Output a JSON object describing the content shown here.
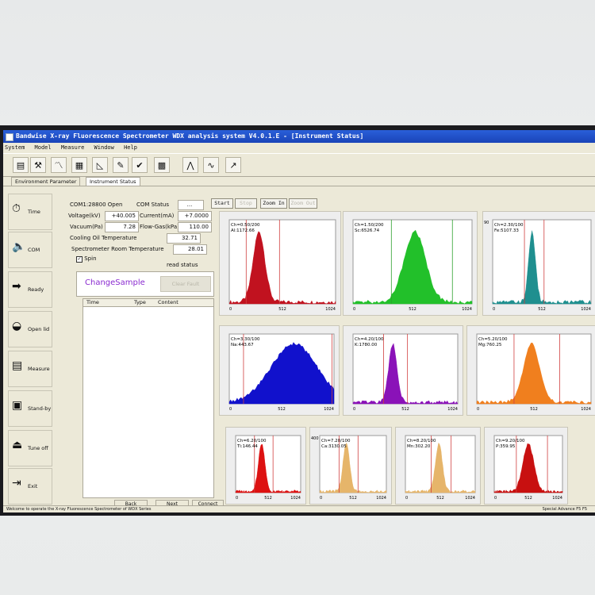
{
  "window": {
    "title": "Bandwise X-ray Fluorescence Spectrometer WDX analysis system V4.0.1.E - [Instrument Status]"
  },
  "menu": [
    "System",
    "Model",
    "Measure",
    "Window",
    "Help"
  ],
  "tabs": [
    "Environment Parameter",
    "Instrument Status"
  ],
  "sidebar": [
    {
      "label": "Time",
      "icon": "clock-icon",
      "glyph": "⏱"
    },
    {
      "label": "COM",
      "icon": "speaker-icon",
      "glyph": "🔈"
    },
    {
      "label": "Ready",
      "icon": "ready-icon",
      "glyph": "➡"
    },
    {
      "label": "Open lid",
      "icon": "open-lid-icon",
      "glyph": "◒"
    },
    {
      "label": "Measure",
      "icon": "measure-icon",
      "glyph": "▤"
    },
    {
      "label": "Stand-by",
      "icon": "standby-icon",
      "glyph": "▣"
    },
    {
      "label": "Tune off",
      "icon": "tune-off-icon",
      "glyph": "⏏"
    },
    {
      "label": "Exit",
      "icon": "exit-icon",
      "glyph": "⇥"
    }
  ],
  "status": {
    "com": "COM1:28800 Open",
    "com_status_label": "COM Status",
    "com_status_value": "...",
    "voltage_label": "Voltage(kV)",
    "voltage_value": "+40.005",
    "current_label": "Current(mA)",
    "current_value": "+7.0000",
    "vacuum_label": "Vacuum(Pa)",
    "vacuum_value": "7.28",
    "flowgas_label": "Flow-Gas(kPa)",
    "flowgas_value": "110.00",
    "oil_label": "Cooling Oil Temperature",
    "oil_value": "32.71",
    "room_label": "Spectrometer Room Temperature",
    "room_value": "28.01",
    "spin_label": "Spin",
    "spin_checked": true,
    "read_status": "read status",
    "change_sample": "ChangeSample",
    "clear_fault": "Clear Fault"
  },
  "log": {
    "columns": [
      "Time",
      "Type",
      "Content"
    ]
  },
  "bottom_buttons": [
    "Back",
    "Next",
    "Connect"
  ],
  "controls": [
    "Start",
    "Stop",
    "Zoom In",
    "Zoom Out"
  ],
  "spectra": [
    {
      "ch": "Ch=0.50/200",
      "el": "Al:1172.66",
      "color": "#c1121f",
      "ymax": "",
      "peak": 0.28,
      "width": 0.055
    },
    {
      "ch": "Ch=1.50/200",
      "el": "Sc:6526.74",
      "color": "#22c02a",
      "ymax": "",
      "peak": 0.52,
      "width": 0.09
    },
    {
      "ch": "Ch=2.30/100",
      "el": "Fe:5107.33",
      "color": "#1f8f8f",
      "ymax": "90",
      "peak": 0.4,
      "width": 0.035
    },
    {
      "ch": "Ch=3.30/100",
      "el": "Na:443.67",
      "color": "#1111cc",
      "ymax": "",
      "peak": 0.62,
      "width": 0.22
    },
    {
      "ch": "Ch=4.20/100",
      "el": "K:1780.00",
      "color": "#8a12b8",
      "ymax": "",
      "peak": 0.38,
      "width": 0.04
    },
    {
      "ch": "Ch=5.20/100",
      "el": "Mg:760.25",
      "color": "#f07f1e",
      "ymax": "",
      "peak": 0.48,
      "width": 0.07
    },
    {
      "ch": "Ch=6.20/100",
      "el": "Ti:146.44",
      "color": "#dd1111",
      "ymax": "",
      "peak": 0.4,
      "width": 0.05
    },
    {
      "ch": "Ch=7.20/100",
      "el": "Ca:3130.05",
      "color": "#e6b56a",
      "ymax": "400",
      "peak": 0.4,
      "width": 0.05
    },
    {
      "ch": "Ch=8.20/100",
      "el": "Mn:302.20",
      "color": "#e6b56a",
      "ymax": "",
      "peak": 0.48,
      "width": 0.05
    },
    {
      "ch": "Ch=9.20/100",
      "el": "P:359.95",
      "color": "#c81010",
      "ymax": "",
      "peak": 0.5,
      "width": 0.08
    }
  ],
  "axis_ticks": [
    "0",
    "512",
    "1024"
  ],
  "statusbar": {
    "text": "Welcome to operate the X-ray Fluorescence Spectrometer of WDX Series",
    "right": "Special   Advance   F5   F5"
  }
}
